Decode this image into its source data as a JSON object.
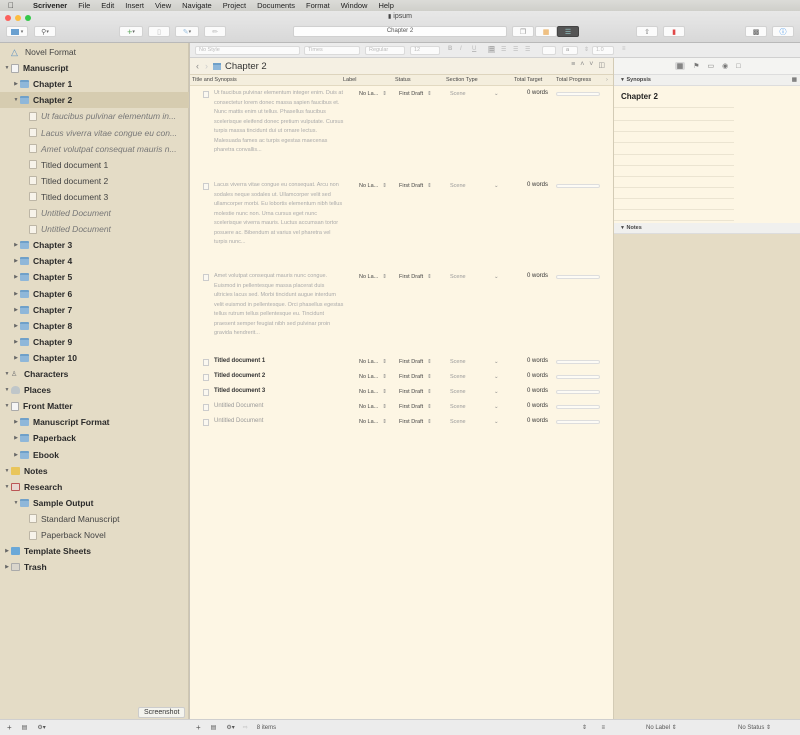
{
  "menubar": {
    "apple": "",
    "items": [
      "Scrivener",
      "File",
      "Edit",
      "Insert",
      "View",
      "Navigate",
      "Project",
      "Documents",
      "Format",
      "Window",
      "Help"
    ]
  },
  "window": {
    "title": "ipsum",
    "title_field": "Chapter 2"
  },
  "colors": {
    "binder_bg": "#e4dcc6",
    "editor_bg": "#fdf6e4",
    "selection": "#d6ccb0",
    "folder": "#8fb7d9",
    "bookmark_red": "#e04848",
    "info_blue": "#1a7fe6"
  },
  "binder": {
    "items": [
      {
        "label": "Novel Format",
        "icon": "novel-format-icon",
        "style": "plain"
      },
      {
        "label": "Manuscript",
        "icon": "draft-icon",
        "style": "bold",
        "expanded": true
      },
      {
        "label": "Chapter 1",
        "icon": "folder-icon",
        "style": "bold",
        "expanded": false
      },
      {
        "label": "Chapter 2",
        "icon": "folder-icon",
        "style": "bold",
        "expanded": true,
        "selected": true
      },
      {
        "label": "Ut faucibus pulvinar elementum in...",
        "icon": "document-icon",
        "style": "italic"
      },
      {
        "label": "Lacus viverra vitae congue eu con...",
        "icon": "document-icon",
        "style": "italic"
      },
      {
        "label": "Amet volutpat consequat mauris n...",
        "icon": "document-icon",
        "style": "italic"
      },
      {
        "label": "Titled document 1",
        "icon": "document-icon",
        "style": "bold-plain"
      },
      {
        "label": "Titled document 2",
        "icon": "document-icon",
        "style": "bold-plain"
      },
      {
        "label": "Titled document 3",
        "icon": "document-icon",
        "style": "bold-plain"
      },
      {
        "label": "Untitled Document",
        "icon": "document-icon",
        "style": "italic"
      },
      {
        "label": "Untitled Document",
        "icon": "document-icon",
        "style": "italic"
      },
      {
        "label": "Chapter 3",
        "icon": "folder-icon",
        "style": "bold",
        "expanded": false
      },
      {
        "label": "Chapter 4",
        "icon": "folder-icon",
        "style": "bold",
        "expanded": false
      },
      {
        "label": "Chapter 5",
        "icon": "folder-icon",
        "style": "bold",
        "expanded": false
      },
      {
        "label": "Chapter 6",
        "icon": "folder-icon",
        "style": "bold",
        "expanded": false
      },
      {
        "label": "Chapter 7",
        "icon": "folder-icon",
        "style": "bold",
        "expanded": false
      },
      {
        "label": "Chapter 8",
        "icon": "folder-icon",
        "style": "bold",
        "expanded": false
      },
      {
        "label": "Chapter 9",
        "icon": "folder-icon",
        "style": "bold",
        "expanded": false
      },
      {
        "label": "Chapter 10",
        "icon": "folder-icon",
        "style": "bold",
        "expanded": false
      },
      {
        "label": "Characters",
        "icon": "characters-icon",
        "style": "bold",
        "expanded": true
      },
      {
        "label": "Places",
        "icon": "places-icon",
        "style": "bold",
        "expanded": true
      },
      {
        "label": "Front Matter",
        "icon": "front-matter-icon",
        "style": "bold",
        "expanded": true
      },
      {
        "label": "Manuscript Format",
        "icon": "folder-icon",
        "style": "bold",
        "expanded": false
      },
      {
        "label": "Paperback",
        "icon": "folder-icon",
        "style": "bold",
        "expanded": false
      },
      {
        "label": "Ebook",
        "icon": "folder-icon",
        "style": "bold",
        "expanded": false
      },
      {
        "label": "Notes",
        "icon": "notes-icon",
        "style": "bold",
        "expanded": true
      },
      {
        "label": "Research",
        "icon": "research-icon",
        "style": "bold",
        "expanded": true
      },
      {
        "label": "Sample Output",
        "icon": "folder-icon",
        "style": "bold",
        "expanded": true
      },
      {
        "label": "Standard Manuscript",
        "icon": "document-icon",
        "style": "plain"
      },
      {
        "label": "Paperback Novel",
        "icon": "document-icon",
        "style": "plain"
      },
      {
        "label": "Template Sheets",
        "icon": "template-sheets-icon",
        "style": "bold",
        "expanded": false
      },
      {
        "label": "Trash",
        "icon": "trash-icon",
        "style": "bold",
        "expanded": false
      }
    ]
  },
  "format_bar": {
    "style": "No Style",
    "font": "Times",
    "weight": "Regular",
    "size": "12",
    "line_spacing": "1.0"
  },
  "editor": {
    "title": "Chapter 2",
    "columns": [
      "Title and Synopsis",
      "Label",
      "Status",
      "Section Type",
      "Total Target",
      "Total Progress"
    ],
    "rows": [
      {
        "title": "Ut faucibus pulvinar elementum integer enim. Duis at consectetur lorem donec massa sapien faucibus et. Nunc mattis enim ut tellus. Phasellus faucibus scelerisque eleifend donec pretium vulputate. Cursus turpis massa tincidunt dui ut ornare lectus. Malesuada fames ac turpis egestas maecenas pharetra convallis...",
        "type": "synopsis",
        "label": "No La...",
        "status": "First Draft",
        "section": "Scene",
        "target": "0 words",
        "progress": 0
      },
      {
        "title": "Lacus viverra vitae congue eu consequat. Arcu non sodales neque sodales ut. Ullamcorper velit sed ullamcorper morbi. Eu lobortis elementum nibh tellus molestie nunc non. Urna cursus eget nunc scelerisque viverra mauris. Luctus accumsan tortor posuere ac. Bibendum at varius vel pharetra vel turpis nunc...",
        "type": "synopsis",
        "label": "No La...",
        "status": "First Draft",
        "section": "Scene",
        "target": "0 words",
        "progress": 0
      },
      {
        "title": "Amet volutpat consequat mauris nunc congue. Euismod in pellentesque massa placerat duis ultricies lacus sed. Morbi tincidunt augue interdum velit euismod in pellentesque. Orci phasellus egestas tellus rutrum tellus pellentesque eu. Tincidunt praesent semper feugiat nibh sed pulvinar proin gravida hendrerit...",
        "type": "synopsis",
        "label": "No La...",
        "status": "First Draft",
        "section": "Scene",
        "target": "0 words",
        "progress": 0
      },
      {
        "title": "Titled document 1",
        "type": "bold",
        "label": "No La...",
        "status": "First Draft",
        "section": "Scene",
        "target": "0 words",
        "progress": 0
      },
      {
        "title": "Titled document 2",
        "type": "bold",
        "label": "No La...",
        "status": "First Draft",
        "section": "Scene",
        "target": "0 words",
        "progress": 0
      },
      {
        "title": "Titled document 3",
        "type": "bold",
        "label": "No La...",
        "status": "First Draft",
        "section": "Scene",
        "target": "0 words",
        "progress": 0
      },
      {
        "title": "Untitled Document",
        "type": "untitled",
        "label": "No La...",
        "status": "First Draft",
        "section": "Scene",
        "target": "0 words",
        "progress": 0
      },
      {
        "title": "Untitled Document",
        "type": "untitled",
        "label": "No La...",
        "status": "First Draft",
        "section": "Scene",
        "target": "0 words",
        "progress": 0
      }
    ],
    "footer_count": "8 items"
  },
  "inspector": {
    "synopsis_header": "Synopsis",
    "synopsis_title": "Chapter 2",
    "notes_header": "Notes",
    "label_value": "No Label",
    "status_value": "No Status"
  },
  "tooltip": "Screenshot"
}
